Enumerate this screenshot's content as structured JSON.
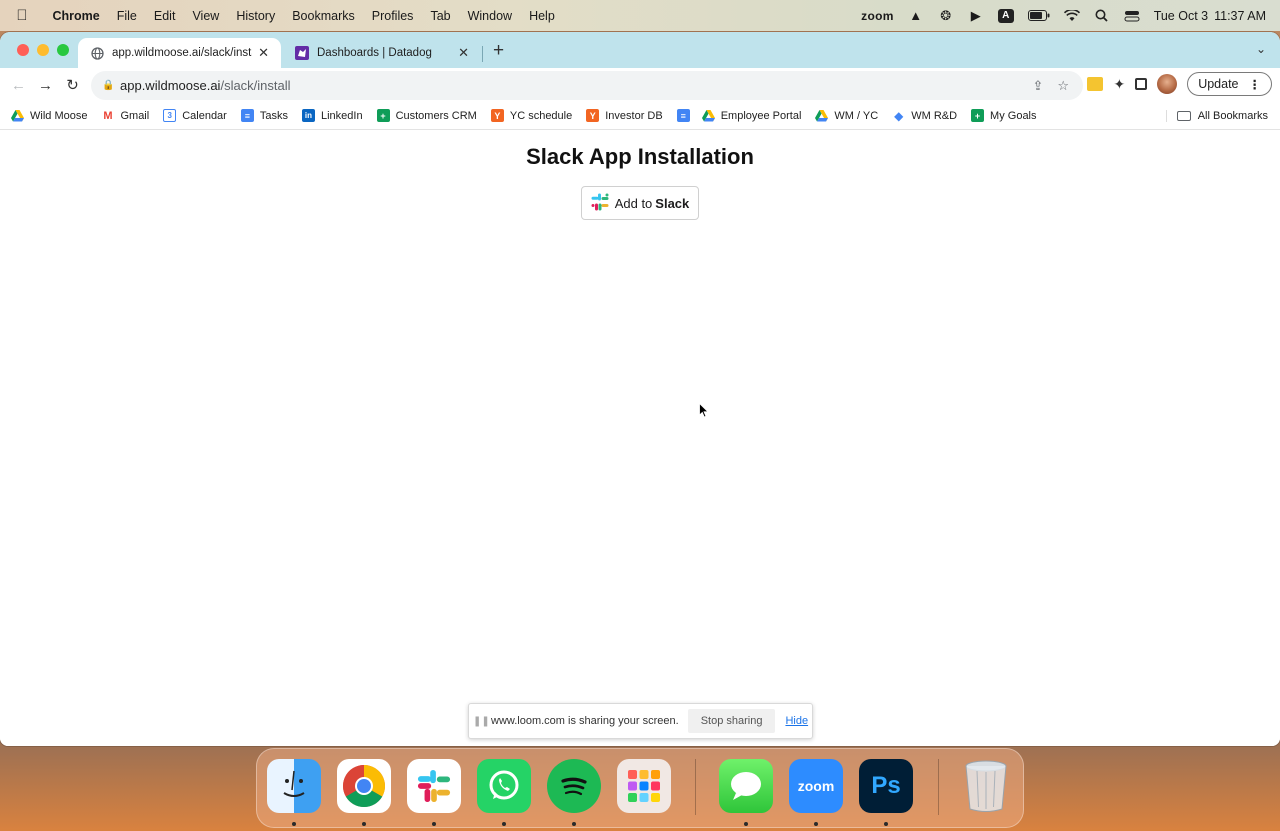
{
  "menubar": {
    "app_name": "Chrome",
    "items": [
      "File",
      "Edit",
      "View",
      "History",
      "Bookmarks",
      "Profiles",
      "Tab",
      "Window",
      "Help"
    ],
    "status_zoom": "zoom",
    "date": "Tue Oct 3",
    "time": "11:37 AM"
  },
  "tabs": [
    {
      "title": "app.wildmoose.ai/slack/install",
      "active": true,
      "icon": "globe-icon"
    },
    {
      "title": "Dashboards | Datadog",
      "active": false,
      "icon": "datadog-icon"
    }
  ],
  "omnibox": {
    "host": "app.wildmoose.ai",
    "path": "/slack/install"
  },
  "toolbar": {
    "update_label": "Update"
  },
  "bookmarks": {
    "items": [
      {
        "label": "Wild Moose",
        "icon": "drive-icon"
      },
      {
        "label": "Gmail",
        "icon": "gmail-icon"
      },
      {
        "label": "Calendar",
        "icon": "calendar-icon"
      },
      {
        "label": "Tasks",
        "icon": "docs-icon"
      },
      {
        "label": "LinkedIn",
        "icon": "linkedin-icon"
      },
      {
        "label": "Customers CRM",
        "icon": "sheets-icon"
      },
      {
        "label": "YC schedule",
        "icon": "yc-icon"
      },
      {
        "label": "Investor DB",
        "icon": "yc-icon"
      },
      {
        "label": "",
        "icon": "docs-icon"
      },
      {
        "label": "Employee Portal",
        "icon": "drive-icon"
      },
      {
        "label": "WM / YC",
        "icon": "drive-icon"
      },
      {
        "label": "WM R&D",
        "icon": "diamond-icon"
      },
      {
        "label": "My Goals",
        "icon": "sheets-icon"
      }
    ],
    "all_label": "All Bookmarks"
  },
  "page": {
    "title": "Slack App Installation",
    "button_prefix": "Add to",
    "button_brand": "Slack"
  },
  "share_bar": {
    "message": "www.loom.com is sharing your screen.",
    "stop_label": "Stop sharing",
    "hide_label": "Hide"
  },
  "dock": {
    "apps": [
      "finder",
      "chrome",
      "slack",
      "whatsapp",
      "spotify",
      "launchpad",
      "messages",
      "zoom",
      "photoshop",
      "trash"
    ],
    "zoom_label": "zoom",
    "photoshop_label": "Ps"
  }
}
